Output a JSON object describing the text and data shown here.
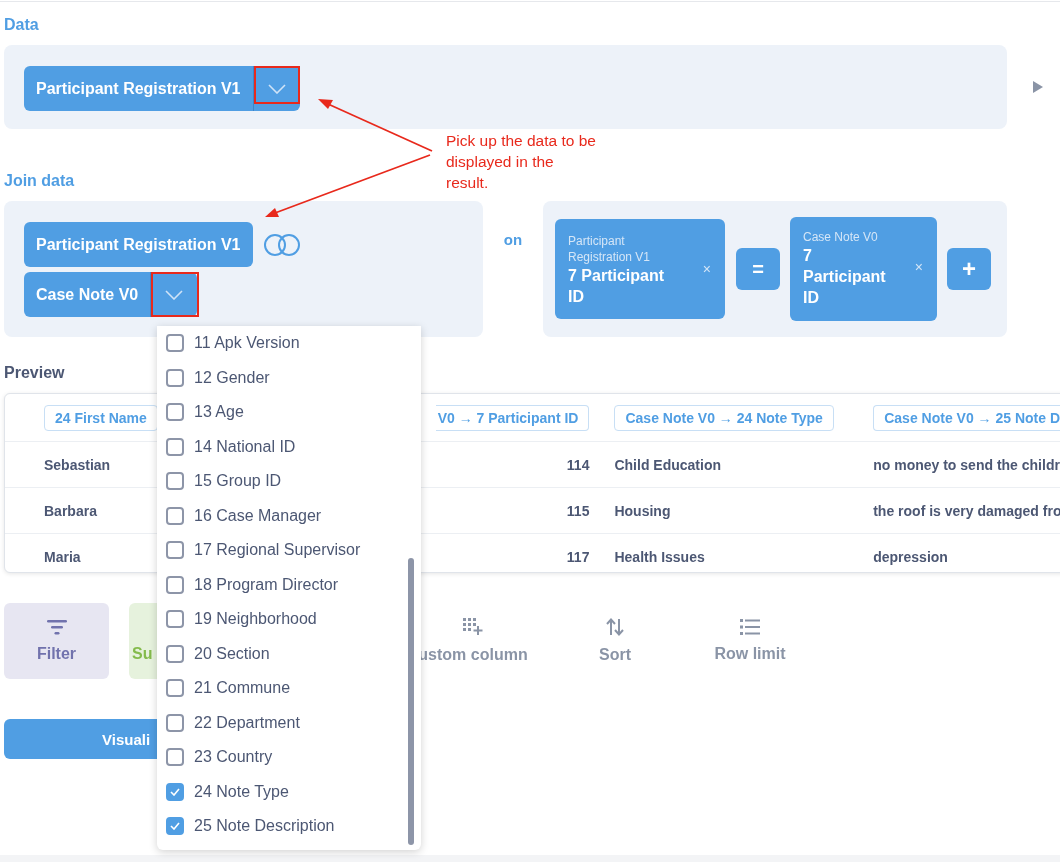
{
  "data_section": {
    "label": "Data",
    "source": "Participant Registration V1"
  },
  "join_section": {
    "label": "Join data",
    "left_source": "Participant Registration V1",
    "right_source": "Case Note V0",
    "on_label": "on",
    "condition": {
      "left": {
        "table": "Participant Registration V1",
        "field": "7 Participant ID",
        "remove": "×"
      },
      "operator": "=",
      "right": {
        "table": "Case Note V0",
        "field": "7 Participant ID",
        "remove": "×"
      },
      "add": "+"
    }
  },
  "annotation": {
    "text": "Pick up the data to be displayed in the result."
  },
  "preview": {
    "label": "Preview",
    "columns": [
      "24 First Name",
      "V0 → 7 Participant ID",
      "Case Note V0 → 24 Note Type",
      "Case Note V0 → 25 Note D"
    ],
    "rows": [
      [
        "Sebastian",
        "114",
        "Child Education",
        "no money to send the childr"
      ],
      [
        "Barbara",
        "115",
        "Housing",
        "the roof is very damaged fro"
      ],
      [
        "Maria",
        "117",
        "Health Issues",
        "depression"
      ]
    ]
  },
  "actions": [
    {
      "label": "Filter",
      "kind": "filter"
    },
    {
      "label": "Su",
      "kind": "summarize"
    },
    {
      "label": "ustom column",
      "kind": "custom"
    },
    {
      "label": "Sort",
      "kind": "sort"
    },
    {
      "label": "Row limit",
      "kind": "limit"
    }
  ],
  "visualize_button": "Visuali",
  "dropdown": {
    "items": [
      {
        "label": "11 Apk Version",
        "checked": false
      },
      {
        "label": "12 Gender",
        "checked": false
      },
      {
        "label": "13 Age",
        "checked": false
      },
      {
        "label": "14 National ID",
        "checked": false
      },
      {
        "label": "15 Group ID",
        "checked": false
      },
      {
        "label": "16 Case Manager",
        "checked": false
      },
      {
        "label": "17 Regional Supervisor",
        "checked": false
      },
      {
        "label": "18 Program Director",
        "checked": false
      },
      {
        "label": "19 Neighborhood",
        "checked": false
      },
      {
        "label": "20 Section",
        "checked": false
      },
      {
        "label": "21 Commune",
        "checked": false
      },
      {
        "label": "22 Department",
        "checked": false
      },
      {
        "label": "23 Country",
        "checked": false
      },
      {
        "label": "24 Note Type",
        "checked": true
      },
      {
        "label": "25 Note Description",
        "checked": true
      }
    ]
  }
}
